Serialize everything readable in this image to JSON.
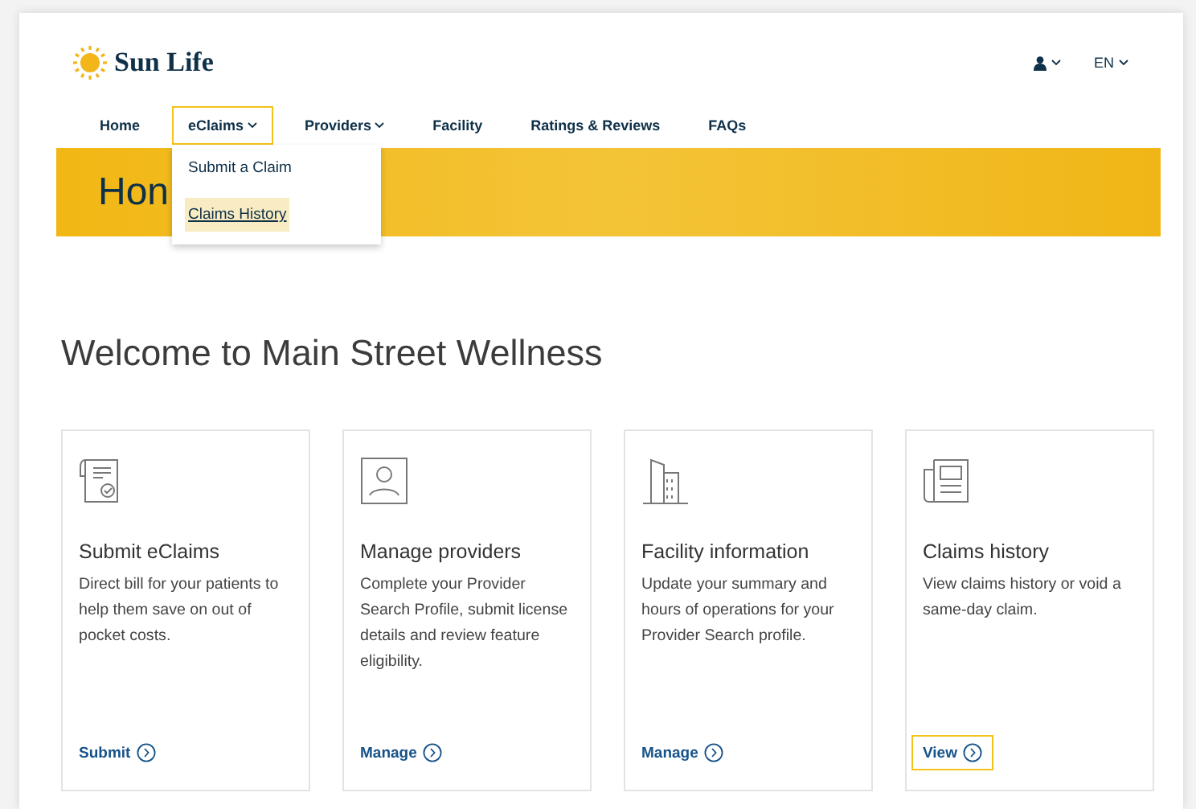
{
  "header": {
    "brand": "Sun Life",
    "language": "EN"
  },
  "nav": [
    {
      "label": "Home",
      "has_menu": false,
      "focused": false
    },
    {
      "label": "eClaims",
      "has_menu": true,
      "focused": true,
      "menu": [
        {
          "label": "Submit a Claim",
          "selected": false
        },
        {
          "label": "Claims History",
          "selected": true
        }
      ]
    },
    {
      "label": "Providers",
      "has_menu": true,
      "focused": false
    },
    {
      "label": "Facility",
      "has_menu": false,
      "focused": false
    },
    {
      "label": "Ratings & Reviews",
      "has_menu": false,
      "focused": false
    },
    {
      "label": "FAQs",
      "has_menu": false,
      "focused": false
    }
  ],
  "banner": {
    "title": "Hon"
  },
  "heading": "Welcome to Main Street Wellness",
  "cards": [
    {
      "kind": "claim",
      "title": "Submit eClaims",
      "text": "Direct bill for your patients to help them save on out of pocket costs.",
      "link": "Submit",
      "focused": false
    },
    {
      "kind": "person",
      "title": "Manage providers",
      "text": "Complete your Provider Search Profile, submit license details and review feature eligibility.",
      "link": "Manage",
      "focused": false
    },
    {
      "kind": "building",
      "title": "Facility information",
      "text": "Update your summary and hours of operations for your Provider Search profile.",
      "link": "Manage",
      "focused": false
    },
    {
      "kind": "history",
      "title": "Claims history",
      "text": "View claims history or void a same-day claim.",
      "link": "View",
      "focused": true
    }
  ]
}
